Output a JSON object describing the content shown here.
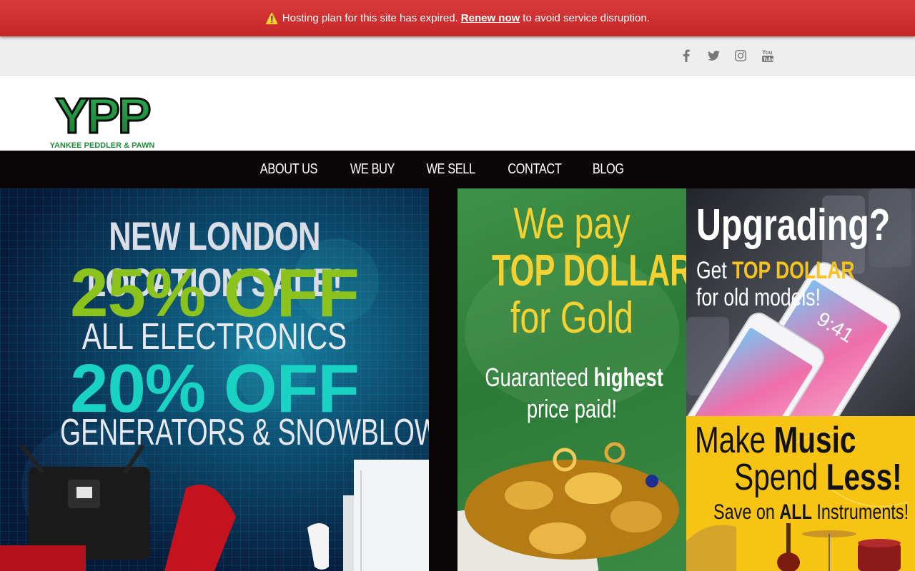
{
  "alert": {
    "icon": "warning-icon",
    "text_before": "Hosting plan for this site has expired.",
    "link": "Renew now",
    "text_after": "to avoid service disruption."
  },
  "social": {
    "icons": [
      "facebook-icon",
      "twitter-icon",
      "instagram-icon",
      "youtube-icon"
    ],
    "youtube_label": "You Tube"
  },
  "logo": {
    "letters": "YPP",
    "tagline": "YANKEE PEDDLER & PAWN"
  },
  "nav": {
    "items": [
      "ABOUT US",
      "WE BUY",
      "WE SELL",
      "CONTACT",
      "BLOG"
    ]
  },
  "banners": {
    "sale": {
      "line1": "NEW LONDON LOCATION SALE!",
      "line2": "25% OFF",
      "line3": "ALL ELECTRONICS",
      "line4": "20% OFF",
      "line5": "GENERATORS & SNOWBLOWERS"
    },
    "gold": {
      "line1": "We pay",
      "line2": "TOP DOLLAR",
      "line3": "for Gold",
      "line4a": "Guaranteed",
      "line4b": "highest",
      "line5": "price paid!"
    },
    "upgrade": {
      "line1": "Upgrading?",
      "line2a": "Get",
      "line2b": "TOP DOLLAR",
      "line3": "for old models!",
      "phone_time": "9:41"
    },
    "music": {
      "line1a": "Make",
      "line1b": "Music",
      "line2a": "Spend",
      "line2b": "Less!",
      "line3a": "Save on",
      "line3b": "ALL",
      "line3c": "Instruments!"
    }
  },
  "colors": {
    "alert_bg": "#c62a2b",
    "nav_bg": "#0b0607",
    "logo_green": "#1f8a3a",
    "sale_green": "#8bc21b",
    "sale_teal": "#19d2c4",
    "gold_yellow": "#f5d232",
    "music_yellow": "#f8c414"
  }
}
